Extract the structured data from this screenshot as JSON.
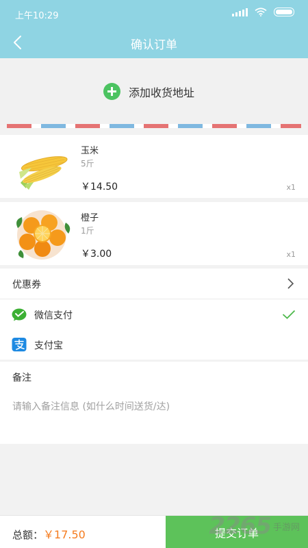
{
  "status_bar": {
    "time": "上午10:29"
  },
  "nav": {
    "title": "确认订单",
    "back_icon": "back-arrow-icon"
  },
  "address": {
    "add_label": "添加收货地址"
  },
  "products": [
    {
      "name": "玉米",
      "spec": "5斤",
      "price": "￥14.50",
      "qty": "x1"
    },
    {
      "name": "橙子",
      "spec": "1斤",
      "price": "￥3.00",
      "qty": "x1"
    }
  ],
  "coupon": {
    "label": "优惠券"
  },
  "payment": {
    "options": [
      {
        "label": "微信支付",
        "selected": true
      },
      {
        "label": "支付宝",
        "selected": false
      }
    ]
  },
  "remark": {
    "label": "备注",
    "placeholder": "请输入备注信息 (如什么时间送货/达)"
  },
  "bottom": {
    "total_label": "总额：",
    "total_amount": "￥17.50",
    "submit_label": "提交订单"
  },
  "watermark": {
    "text": "2265",
    "subtext": "手游网"
  },
  "colors": {
    "header": "#8fd4e3",
    "accent_green": "#5dc25a",
    "price_orange": "#f57c1f"
  }
}
